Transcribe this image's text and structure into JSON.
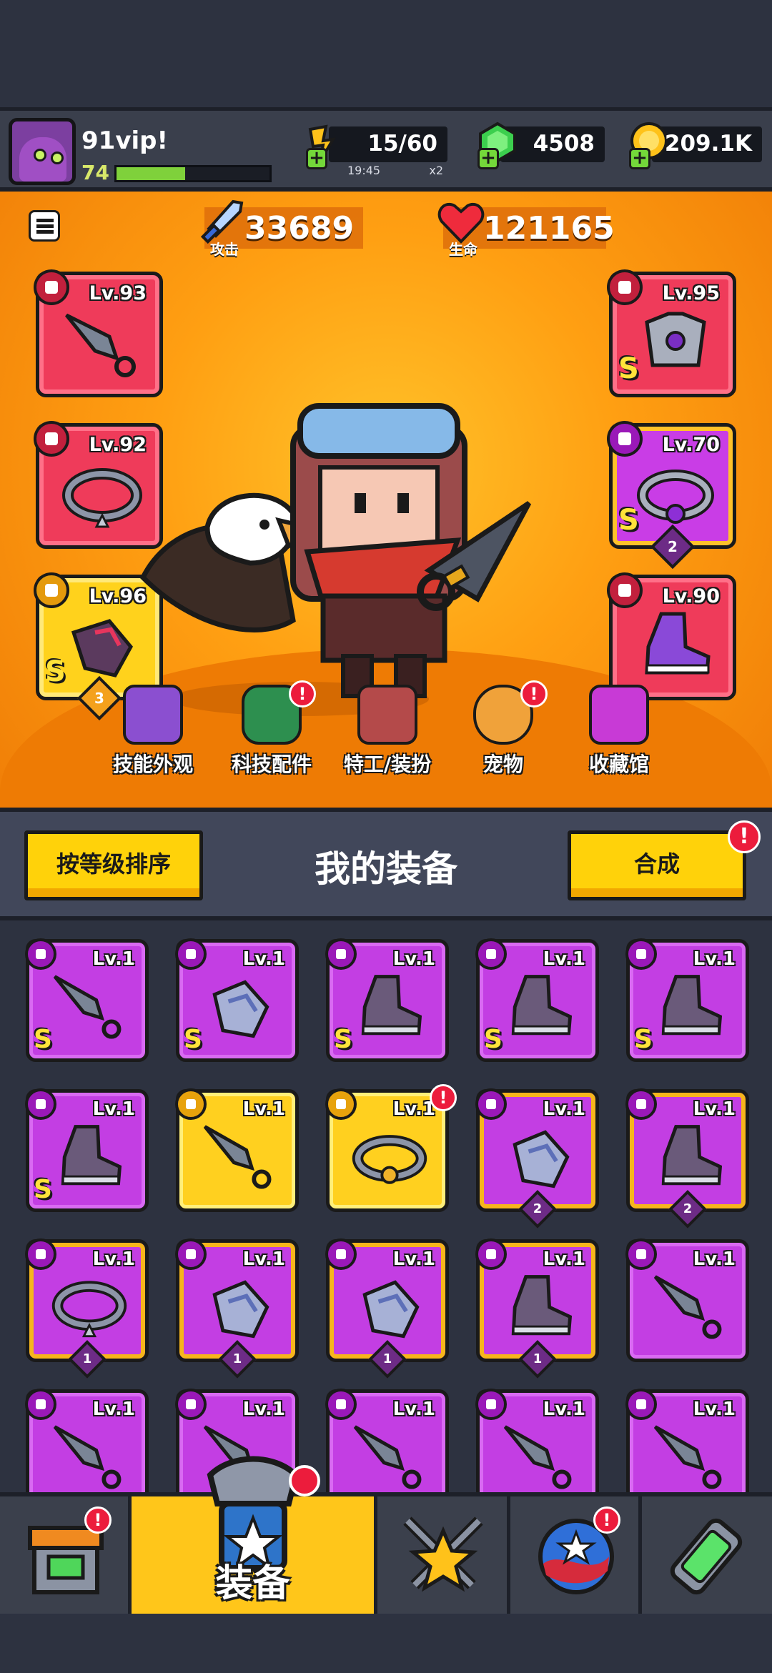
{
  "player": {
    "name": "91vip!",
    "level": "74",
    "xp_fraction": 0.45
  },
  "resources": {
    "energy": {
      "value": "15/60",
      "timer": "19:45",
      "multiplier": "x2"
    },
    "gems": {
      "value": "4508"
    },
    "coins": {
      "value": "209.1K"
    }
  },
  "stats": {
    "attack": {
      "label": "攻击",
      "value": "33689"
    },
    "health": {
      "label": "生命",
      "value": "121165"
    }
  },
  "equipped": {
    "weapon": {
      "level": "Lv.93"
    },
    "necklace": {
      "level": "Lv.92"
    },
    "gloves": {
      "level": "Lv.96",
      "grade": "S",
      "stars": "3"
    },
    "armor": {
      "level": "Lv.95",
      "grade": "S"
    },
    "belt": {
      "level": "Lv.70",
      "grade": "S",
      "stars": "2"
    },
    "boots": {
      "level": "Lv.90"
    }
  },
  "subnav": [
    {
      "label": "技能外观",
      "badge": false
    },
    {
      "label": "科技配件",
      "badge": true
    },
    {
      "label": "特工/装扮",
      "badge": false
    },
    {
      "label": "宠物",
      "badge": true
    },
    {
      "label": "收藏馆",
      "badge": false
    }
  ],
  "inventory": {
    "title": "我的装备",
    "sort_button": "按等级排序",
    "merge_button": "合成",
    "badge_text": "!",
    "items": [
      {
        "icon": "weapon-icon",
        "level": "Lv.1",
        "grade": "S",
        "stars": ""
      },
      {
        "icon": "gloves-icon",
        "level": "Lv.1",
        "grade": "S",
        "stars": ""
      },
      {
        "icon": "boots-icon",
        "level": "Lv.1",
        "grade": "S",
        "stars": ""
      },
      {
        "icon": "boots-icon",
        "level": "Lv.1",
        "grade": "S",
        "stars": ""
      },
      {
        "icon": "boots-icon",
        "level": "Lv.1",
        "grade": "S",
        "stars": ""
      },
      {
        "icon": "boots-icon",
        "level": "Lv.1",
        "grade": "S",
        "stars": ""
      },
      {
        "icon": "weapon-icon",
        "level": "Lv.1",
        "grade": "",
        "stars": ""
      },
      {
        "icon": "belt-icon",
        "level": "Lv.1",
        "grade": "",
        "stars": ""
      },
      {
        "icon": "gloves-icon",
        "level": "Lv.1",
        "grade": "",
        "stars": "2"
      },
      {
        "icon": "boots-icon",
        "level": "Lv.1",
        "grade": "",
        "stars": "2"
      },
      {
        "icon": "necklace-icon",
        "level": "Lv.1",
        "grade": "",
        "stars": "1"
      },
      {
        "icon": "gloves-icon",
        "level": "Lv.1",
        "grade": "",
        "stars": "1"
      },
      {
        "icon": "gloves-icon",
        "level": "Lv.1",
        "grade": "",
        "stars": "1"
      },
      {
        "icon": "boots-icon",
        "level": "Lv.1",
        "grade": "",
        "stars": "1"
      },
      {
        "icon": "weapon-icon",
        "level": "Lv.1",
        "grade": "",
        "stars": ""
      },
      {
        "icon": "weapon-icon",
        "level": "Lv.1",
        "grade": "",
        "stars": ""
      },
      {
        "icon": "weapon-icon",
        "level": "Lv.1",
        "grade": "",
        "stars": ""
      },
      {
        "icon": "weapon-icon",
        "level": "Lv.1",
        "grade": "",
        "stars": ""
      },
      {
        "icon": "weapon-icon",
        "level": "Lv.1",
        "grade": "",
        "stars": ""
      },
      {
        "icon": "weapon-icon",
        "level": "Lv.1",
        "grade": "",
        "stars": ""
      }
    ]
  },
  "bottom_nav": {
    "shop": {
      "icon": "shop-icon"
    },
    "equipment": {
      "label": "装备",
      "icon": "equipment-icon"
    },
    "battle": {
      "icon": "crossed-swords-icon"
    },
    "events": {
      "icon": "stars-ball-icon"
    },
    "lab": {
      "icon": "dna-capsule-icon"
    }
  },
  "colors": {
    "orange_bg": "#ff9f12",
    "accent_yellow": "#ffd20a",
    "rare_purple": "#c33ee3",
    "epic_red": "#ef3b5a",
    "alert_red": "#ec1c3c"
  }
}
